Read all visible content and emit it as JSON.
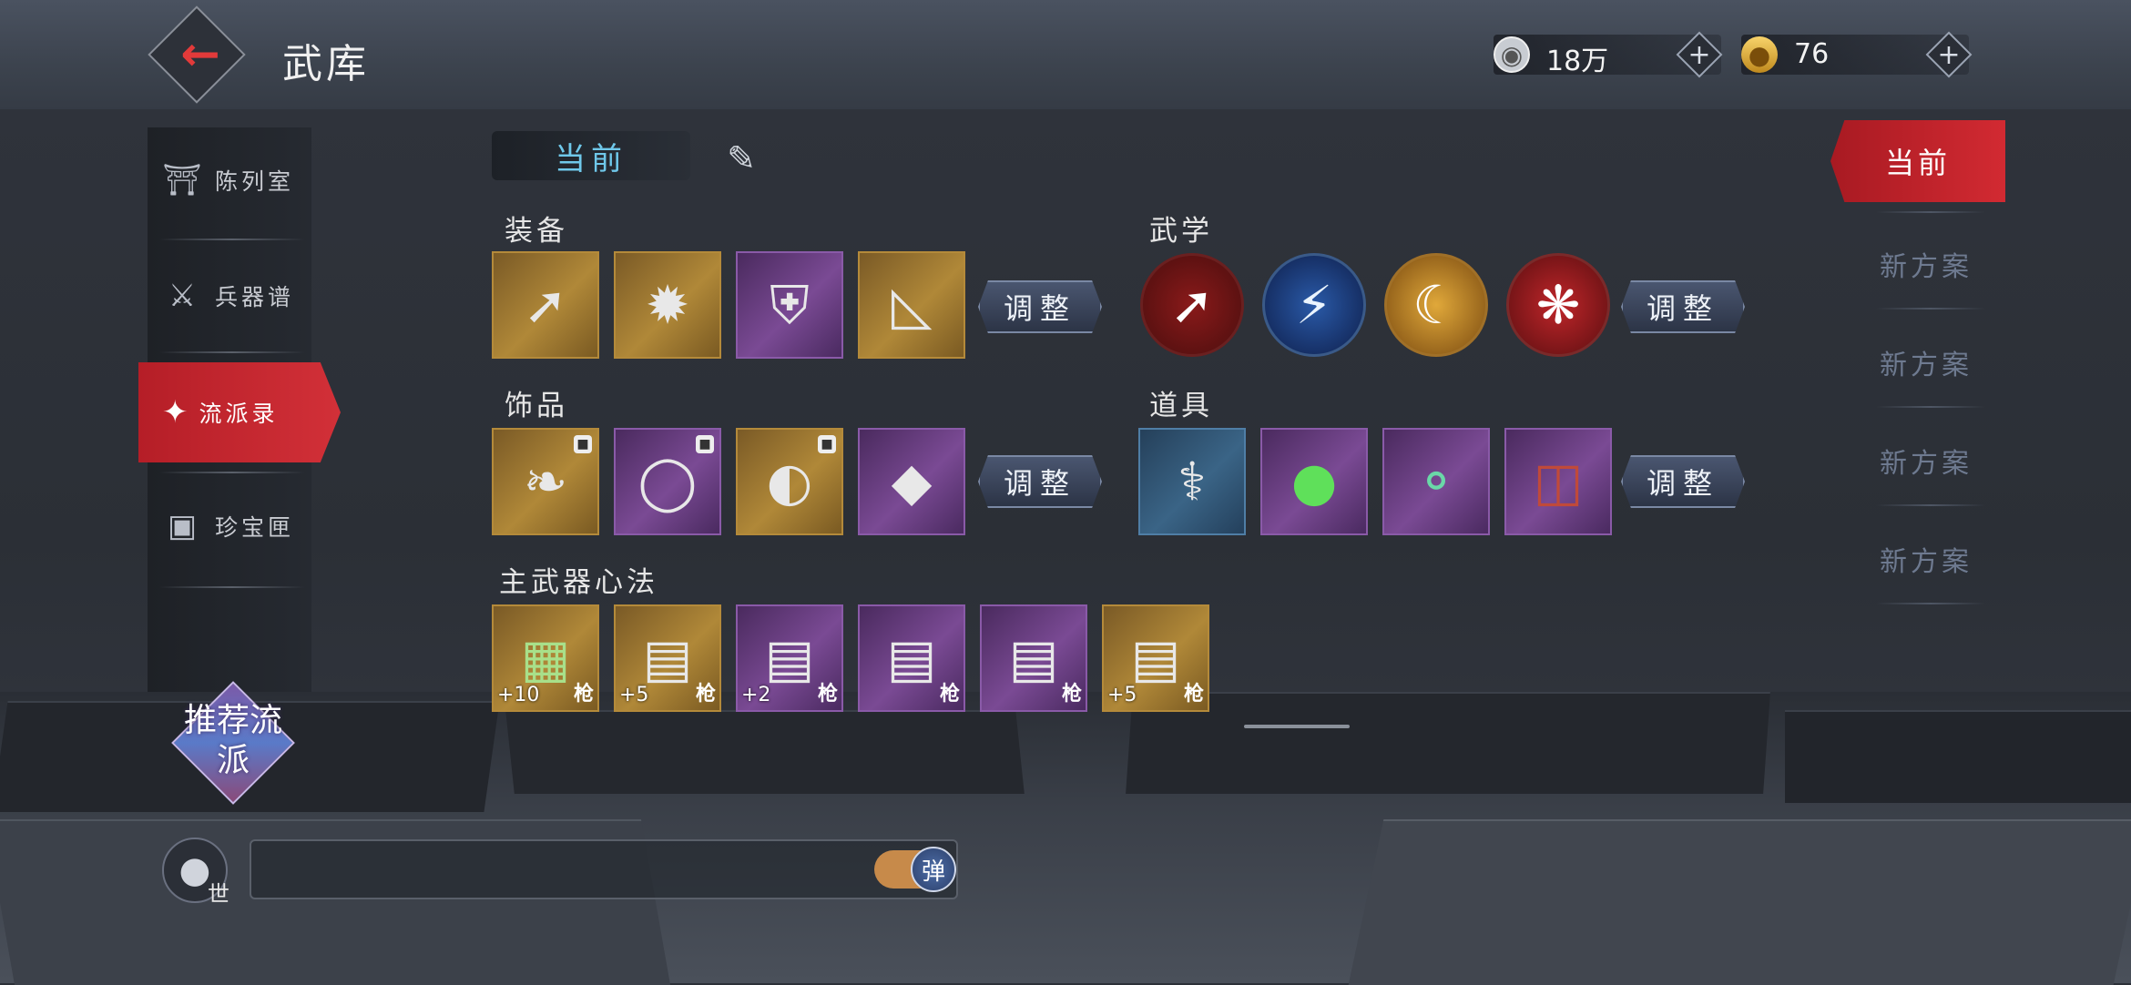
{
  "header": {
    "title": "武库",
    "silver": "18万",
    "gold": "76",
    "back_icon": "back-arrow-icon"
  },
  "nav": {
    "items": [
      {
        "label": "陈列室",
        "icon": "pavilion-icon"
      },
      {
        "label": "兵器谱",
        "icon": "weapon-rack-icon"
      },
      {
        "label": "流派录",
        "icon": "sect-record-icon"
      },
      {
        "label": "珍宝匣",
        "icon": "treasure-chest-icon"
      }
    ],
    "active_index": 2,
    "recommend": "推荐流派"
  },
  "current_tab": {
    "label": "当前"
  },
  "sections": {
    "equipment": "装备",
    "martial": "武学",
    "accessory": "饰品",
    "items": "道具",
    "weapon_art": "主武器心法"
  },
  "adjust_label": "调整",
  "weapon_art_levels": [
    "+10",
    "+5",
    "+2",
    "",
    "",
    "+5"
  ],
  "plans": {
    "current": "当前",
    "others": [
      "新方案",
      "新方案",
      "新方案",
      "新方案"
    ]
  },
  "chat": {
    "world": "世",
    "toggle": "弹"
  },
  "colors": {
    "accent_red": "#d23038",
    "tab_cyan": "#6fc8ea",
    "plan_muted": "#6e7a90"
  }
}
